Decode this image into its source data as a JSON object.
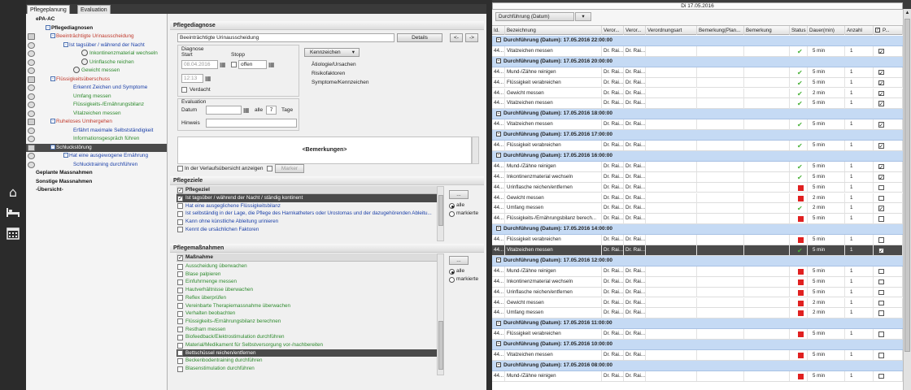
{
  "tabs": [
    "Pflegeplanung",
    "Evaluation"
  ],
  "nav_icons": [
    "home-icon",
    "bed-icon",
    "calendar-icon"
  ],
  "tree": {
    "rows": [
      {
        "label": "ePA-AC",
        "indent": 0,
        "cls": "bold dark",
        "gut": "",
        "box": ""
      },
      {
        "label": "Pflegediagnosen",
        "indent": 12,
        "cls": "bold dark",
        "gut": "",
        "box": "-"
      },
      {
        "label": "Beeinträchtigte Urinausscheidung",
        "indent": 18,
        "cls": "red",
        "gut": "sq",
        "box": "-"
      },
      {
        "label": "Ist tagsüber / während der Nacht",
        "indent": 34,
        "cls": "blue",
        "gut": "c",
        "box": "-"
      },
      {
        "label": "Inkontinenzmaterial wechseln",
        "indent": 56,
        "cls": "green",
        "gut": "c",
        "box": "",
        "icon": true
      },
      {
        "label": "Urinflasche reichen",
        "indent": 56,
        "cls": "green",
        "gut": "c",
        "box": "",
        "icon": true
      },
      {
        "label": "Gewicht messen",
        "indent": 46,
        "cls": "green",
        "gut": "c",
        "box": "",
        "icon": true
      },
      {
        "label": "Flüssigkeitsüberschuss",
        "indent": 18,
        "cls": "red",
        "gut": "sq",
        "box": "-"
      },
      {
        "label": "Erkennt Zeichen und Symptome",
        "indent": 46,
        "cls": "blue",
        "gut": "c",
        "box": ""
      },
      {
        "label": "Umfang messen",
        "indent": 46,
        "cls": "green",
        "gut": "c",
        "box": ""
      },
      {
        "label": "Flüssigkeits-/Ernährungsbilanz",
        "indent": 46,
        "cls": "green",
        "gut": "c",
        "box": ""
      },
      {
        "label": "Vitalzeichen messen",
        "indent": 46,
        "cls": "green",
        "gut": "c",
        "box": ""
      },
      {
        "label": "Ruheloses Umhergehen",
        "indent": 18,
        "cls": "red",
        "gut": "sq",
        "box": "-"
      },
      {
        "label": "Erfährt maximale Selbstständigkeit",
        "indent": 46,
        "cls": "blue",
        "gut": "c",
        "box": ""
      },
      {
        "label": "Informationsgespräch führen",
        "indent": 46,
        "cls": "green",
        "gut": "c",
        "box": ""
      },
      {
        "label": "Schluckstörung",
        "indent": 18,
        "cls": "sel",
        "gut": "sq",
        "box": "-"
      },
      {
        "label": "Hat eine ausgewogene Ernährung",
        "indent": 34,
        "cls": "blue",
        "gut": "c",
        "box": "-"
      },
      {
        "label": "Schlucktraining durchführen",
        "indent": 46,
        "cls": "blue",
        "gut": "c",
        "box": ""
      },
      {
        "label": "Geplante Massnahmen",
        "indent": 0,
        "cls": "bold dark",
        "gut": "",
        "box": ""
      },
      {
        "label": "Sonstige Massnahmen",
        "indent": 0,
        "cls": "bold dark",
        "gut": "",
        "box": ""
      },
      {
        "label": "-Übersicht-",
        "indent": 0,
        "cls": "bold dark",
        "gut": "",
        "box": ""
      }
    ]
  },
  "diagnose": {
    "header": "Pflegediagnose",
    "value": "Beeinträchtigte Urinausscheidung",
    "details_btn": "Details",
    "prev_btn": "<-",
    "next_btn": "->",
    "group_label": "Diagnose",
    "start_label": "Start",
    "stopp_label": "Stopp",
    "start_date": "08.04.2016",
    "stopp_value": "offen",
    "time": "12:13",
    "verdacht_label": "Verdacht",
    "eval_label": "Evaluation",
    "datum_label": "Datum",
    "alle_label": "alle",
    "tage_value": "7",
    "tage_label": "Tage",
    "hinweis_label": "Hinweis",
    "kennzeichen_btn": "Kennzeichen",
    "kenn_items": [
      "Ätiologie/Ursachen",
      "Risikofaktoren",
      "Symptome/Kennzeichen"
    ],
    "bemerkungen": "<Bemerkungen>",
    "verlauf_label": "In der Verlaufsübersicht anzeigen",
    "marker_btn": "Marker"
  },
  "ziele": {
    "header": "Pflegeziele",
    "col": "Pflegeziel",
    "items": [
      {
        "label": "Ist tagsüber / während der Nacht / ständig kontinent",
        "checked": true,
        "sel": true
      },
      {
        "label": "Hat eine ausgeglichene Flüssigkeitsbilanz",
        "checked": false,
        "sel": false
      },
      {
        "label": "Ist selbständig in der Lage, die Pflege des Harnkatheters oder Urostomas und der dazugehörenden Ableitu...",
        "checked": false,
        "sel": false
      },
      {
        "label": "Kann ohne künstliche Ableitung urinieren",
        "checked": false,
        "sel": false
      },
      {
        "label": "Kennt die ursächlichen Faktoren",
        "checked": false,
        "sel": false
      }
    ],
    "more_btn": "...",
    "radio": [
      "alle",
      "markierte"
    ]
  },
  "massnahmen": {
    "header": "Pflegemaßnahmen",
    "col": "Maßnahme",
    "items": [
      {
        "label": "Ausscheidung überwachen",
        "checked": false,
        "sel": false
      },
      {
        "label": "Blase palpieren",
        "checked": false,
        "sel": false
      },
      {
        "label": "Einfuhrmenge messen",
        "checked": false,
        "sel": false
      },
      {
        "label": "Hautverhältnisse überwachen",
        "checked": false,
        "sel": false
      },
      {
        "label": "Reflex überprüfen",
        "checked": false,
        "sel": false
      },
      {
        "label": "Vereinbarte Therapiemassnahme überwachen",
        "checked": false,
        "sel": false
      },
      {
        "label": "Verhalten beobachten",
        "checked": false,
        "sel": false
      },
      {
        "label": "Flüssigkeits-/Ernährungsbilanz berechnen",
        "checked": false,
        "sel": false
      },
      {
        "label": "Restharn messen",
        "checked": false,
        "sel": false
      },
      {
        "label": "Biofeedback/Elektrostimulation durchführen",
        "checked": false,
        "sel": false
      },
      {
        "label": "Material/Medikament für Selbstversorgung vor-/nachbereiten",
        "checked": false,
        "sel": false
      },
      {
        "label": "Bettschüssel reichen/entfernen",
        "checked": false,
        "sel": true
      },
      {
        "label": "Beckenbodentraining durchführen",
        "checked": false,
        "sel": false
      },
      {
        "label": "Blasenstimulation durchführen",
        "checked": false,
        "sel": false
      }
    ],
    "more_btn": "...",
    "radio": [
      "alle",
      "markierte"
    ]
  },
  "right": {
    "date": "Di 17.05.2016",
    "group_by": "Durchführung (Datum)",
    "columns": [
      "Id.",
      "Bezeichnung",
      "Veror...",
      "Veror...",
      "Verordnungsart",
      "Bemerkung(Plan...",
      "Bemerkung",
      "Status",
      "Dauer(min)",
      "Anzahl",
      "P..."
    ],
    "rows": [
      {
        "t": "g",
        "label": "Durchführung (Datum): 17.05.2016 22:00:00"
      },
      {
        "t": "r",
        "id": "44...",
        "name": "Vitalzeichen messen",
        "v1": "Dr. Rai...",
        "v2": "Dr. Rai...",
        "status": "ok",
        "dauer": "5 min",
        "anzahl": "1",
        "p": true
      },
      {
        "t": "g",
        "label": "Durchführung (Datum): 17.05.2016 20:00:00"
      },
      {
        "t": "r",
        "id": "44...",
        "name": "Mund-/Zähne reinigen",
        "v1": "Dr. Rai...",
        "v2": "Dr. Rai...",
        "status": "ok",
        "dauer": "5 min",
        "anzahl": "1",
        "p": true
      },
      {
        "t": "r",
        "id": "44...",
        "name": "Flüssigkeit verabreichen",
        "v1": "Dr. Rai...",
        "v2": "Dr. Rai...",
        "status": "ok",
        "dauer": "5 min",
        "anzahl": "1",
        "p": true
      },
      {
        "t": "r",
        "id": "44...",
        "name": "Gewicht messen",
        "v1": "Dr. Rai...",
        "v2": "Dr. Rai...",
        "status": "ok",
        "dauer": "2 min",
        "anzahl": "1",
        "p": true
      },
      {
        "t": "r",
        "id": "44...",
        "name": "Vitalzeichen messen",
        "v1": "Dr. Rai...",
        "v2": "Dr. Rai...",
        "status": "ok",
        "dauer": "5 min",
        "anzahl": "1",
        "p": true
      },
      {
        "t": "g",
        "label": "Durchführung (Datum): 17.05.2016 18:00:00"
      },
      {
        "t": "r",
        "id": "44...",
        "name": "Vitalzeichen messen",
        "v1": "Dr. Rai...",
        "v2": "Dr. Rai...",
        "status": "ok",
        "dauer": "5 min",
        "anzahl": "1",
        "p": true
      },
      {
        "t": "g",
        "label": "Durchführung (Datum): 17.05.2016 17:00:00"
      },
      {
        "t": "r",
        "id": "44...",
        "name": "Flüssigkeit verabreichen",
        "v1": "Dr. Rai...",
        "v2": "Dr. Rai...",
        "status": "ok",
        "dauer": "5 min",
        "anzahl": "1",
        "p": true
      },
      {
        "t": "g",
        "label": "Durchführung (Datum): 17.05.2016 16:00:00"
      },
      {
        "t": "r",
        "id": "44...",
        "name": "Mund-/Zähne reinigen",
        "v1": "Dr. Rai...",
        "v2": "Dr. Rai...",
        "status": "ok",
        "dauer": "5 min",
        "anzahl": "1",
        "p": true
      },
      {
        "t": "r",
        "id": "44...",
        "name": "Inkontinenzmaterial wechseln",
        "v1": "Dr. Rai...",
        "v2": "Dr. Rai...",
        "status": "ok",
        "dauer": "5 min",
        "anzahl": "1",
        "p": true
      },
      {
        "t": "r",
        "id": "44...",
        "name": "Urinflasche reichen/entfernen",
        "v1": "Dr. Rai...",
        "v2": "Dr. Rai...",
        "status": "red",
        "dauer": "5 min",
        "anzahl": "1",
        "p": false
      },
      {
        "t": "r",
        "id": "44...",
        "name": "Gewicht messen",
        "v1": "Dr. Rai...",
        "v2": "Dr. Rai...",
        "status": "red",
        "dauer": "2 min",
        "anzahl": "1",
        "p": false
      },
      {
        "t": "r",
        "id": "44...",
        "name": "Umfang messen",
        "v1": "Dr. Rai...",
        "v2": "Dr. Rai...",
        "status": "ok",
        "dauer": "2 min",
        "anzahl": "1",
        "p": true
      },
      {
        "t": "r",
        "id": "44...",
        "name": "Flüssigkeits-/Ernährungsbilanz berech...",
        "v1": "Dr. Rai...",
        "v2": "Dr. Rai...",
        "status": "red",
        "dauer": "5 min",
        "anzahl": "1",
        "p": false
      },
      {
        "t": "g",
        "label": "Durchführung (Datum): 17.05.2016 14:00:00"
      },
      {
        "t": "r",
        "id": "44...",
        "name": "Flüssigkeit verabreichen",
        "v1": "Dr. Rai...",
        "v2": "Dr. Rai...",
        "status": "red",
        "dauer": "5 min",
        "anzahl": "1",
        "p": false
      },
      {
        "t": "r",
        "id": "44...",
        "name": "Vitalzeichen messen",
        "v1": "Dr. Rai...",
        "v2": "Dr. Rai...",
        "status": "ok",
        "dauer": "5 min",
        "anzahl": "1",
        "p": true,
        "sel": true
      },
      {
        "t": "g",
        "label": "Durchführung (Datum): 17.05.2016 12:00:00"
      },
      {
        "t": "r",
        "id": "44...",
        "name": "Mund-/Zähne reinigen",
        "v1": "Dr. Rai...",
        "v2": "Dr. Rai...",
        "status": "red",
        "dauer": "5 min",
        "anzahl": "1",
        "p": false
      },
      {
        "t": "r",
        "id": "44...",
        "name": "Inkontinenzmaterial wechseln",
        "v1": "Dr. Rai...",
        "v2": "Dr. Rai...",
        "status": "red",
        "dauer": "5 min",
        "anzahl": "1",
        "p": false
      },
      {
        "t": "r",
        "id": "44...",
        "name": "Urinflasche reichen/entfernen",
        "v1": "Dr. Rai...",
        "v2": "Dr. Rai...",
        "status": "red",
        "dauer": "5 min",
        "anzahl": "1",
        "p": false
      },
      {
        "t": "r",
        "id": "44...",
        "name": "Gewicht messen",
        "v1": "Dr. Rai...",
        "v2": "Dr. Rai...",
        "status": "red",
        "dauer": "2 min",
        "anzahl": "1",
        "p": false
      },
      {
        "t": "r",
        "id": "44...",
        "name": "Umfang messen",
        "v1": "Dr. Rai...",
        "v2": "Dr. Rai...",
        "status": "red",
        "dauer": "2 min",
        "anzahl": "1",
        "p": false
      },
      {
        "t": "g",
        "label": "Durchführung (Datum): 17.05.2016 11:00:00"
      },
      {
        "t": "r",
        "id": "44...",
        "name": "Flüssigkeit verabreichen",
        "v1": "Dr. Rai...",
        "v2": "Dr. Rai...",
        "status": "red",
        "dauer": "5 min",
        "anzahl": "1",
        "p": false
      },
      {
        "t": "g",
        "label": "Durchführung (Datum): 17.05.2016 10:00:00"
      },
      {
        "t": "r",
        "id": "44...",
        "name": "Vitalzeichen messen",
        "v1": "Dr. Rai...",
        "v2": "Dr. Rai...",
        "status": "red",
        "dauer": "5 min",
        "anzahl": "1",
        "p": false
      },
      {
        "t": "g",
        "label": "Durchführung (Datum): 17.05.2016 08:00:00"
      },
      {
        "t": "r",
        "id": "44...",
        "name": "Mund-/Zähne reinigen",
        "v1": "Dr. Rai...",
        "v2": "Dr. Rai...",
        "status": "red",
        "dauer": "5 min",
        "anzahl": "1",
        "p": false
      }
    ]
  },
  "colors": {
    "tree_red": "#c0392b",
    "tree_blue": "#1a3fa8",
    "tree_green": "#2d8a2d",
    "group_row": "#c5daf4",
    "status_red": "#e02020",
    "status_ok": "#4bb23a",
    "selection": "#4a4a4a"
  }
}
